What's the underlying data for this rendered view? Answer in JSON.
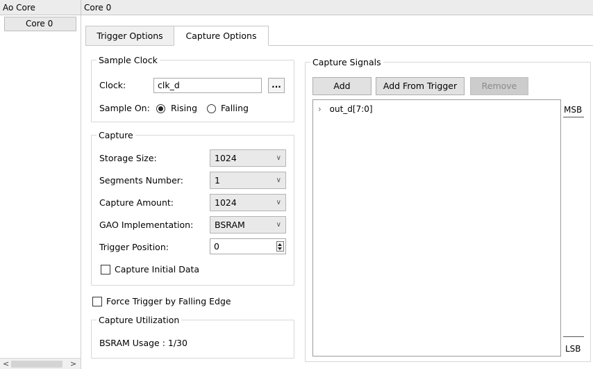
{
  "header": {
    "left_title": "Ao Core",
    "right_title": "Core 0"
  },
  "tree": {
    "items": [
      {
        "label": "Core 0"
      }
    ]
  },
  "tabs": [
    {
      "label": "Trigger Options"
    },
    {
      "label": "Capture Options"
    }
  ],
  "sample_clock": {
    "title": "Sample Clock",
    "clock_label": "Clock:",
    "clock_value": "clk_d",
    "browse_label": "...",
    "sample_on_label": "Sample On:",
    "rising_label": "Rising",
    "falling_label": "Falling",
    "selected": "Rising"
  },
  "capture": {
    "title": "Capture",
    "storage_size_label": "Storage Size:",
    "storage_size_value": "1024",
    "segments_label": "Segments Number:",
    "segments_value": "1",
    "capture_amount_label": "Capture Amount:",
    "capture_amount_value": "1024",
    "gao_label": "GAO Implementation:",
    "gao_value": "BSRAM",
    "trigger_position_label": "Trigger Position:",
    "trigger_position_value": "0",
    "capture_initial_label": "Capture Initial Data",
    "capture_initial_checked": false
  },
  "force_trigger": {
    "label": "Force Trigger by Falling Edge",
    "checked": false
  },
  "capture_utilization": {
    "title": "Capture Utilization",
    "usage_text": "BSRAM Usage : 1/30"
  },
  "capture_signals": {
    "title": "Capture Signals",
    "add_label": "Add",
    "add_from_trigger_label": "Add From Trigger",
    "remove_label": "Remove",
    "signals": [
      {
        "name": "out_d[7:0]"
      }
    ],
    "msb_label": "MSB",
    "lsb_label": "LSB"
  },
  "scroll": {
    "left_arrow": "<",
    "right_arrow": ">"
  },
  "icons": {
    "dropdown": "chevron-down-icon",
    "expand": "chevron-right-icon"
  }
}
